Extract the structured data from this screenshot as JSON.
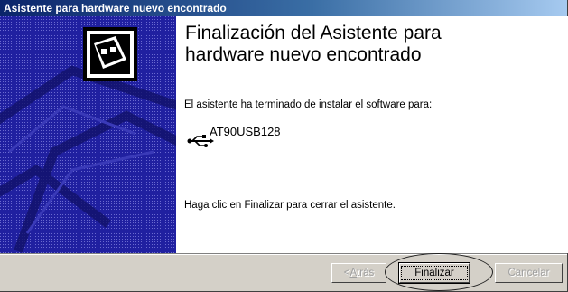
{
  "window": {
    "title": "Asistente para hardware nuevo encontrado"
  },
  "content": {
    "heading": "Finalización del Asistente para hardware nuevo encontrado",
    "intro": "El asistente ha terminado de instalar el software para:",
    "device_name": "AT90USB128",
    "device_icon": "usb-icon",
    "finish_instructions": "Haga clic en Finalizar para cerrar el asistente."
  },
  "buttons": {
    "back_prefix": "< ",
    "back_accel": "A",
    "back_rest": "trás",
    "finish": "Finalizar",
    "cancel": "Cancelar"
  },
  "colors": {
    "titlebar_start": "#0a246a",
    "side_panel": "#1a1a8a",
    "dialog_face": "#d4d0c8"
  }
}
